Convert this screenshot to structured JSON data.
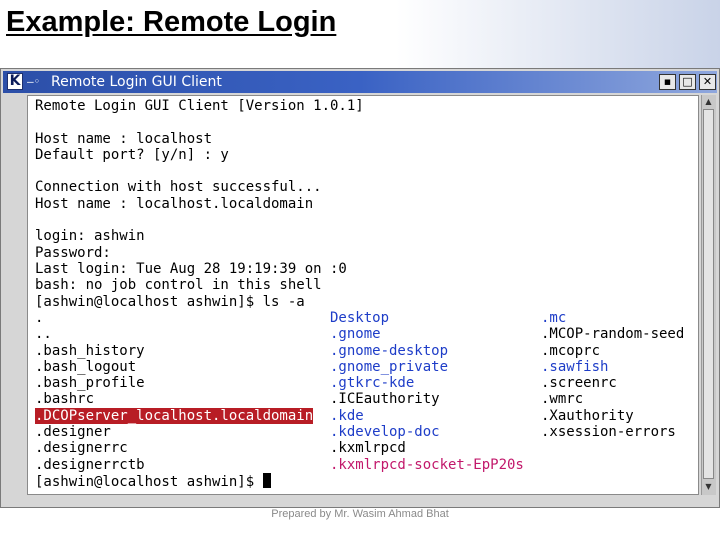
{
  "slide": {
    "title": "Example: Remote Login",
    "footer": "Prepared by Mr. Wasim Ahmad Bhat"
  },
  "window": {
    "title": "Remote Login GUI Client",
    "app_icon": "K",
    "buttons": [
      "minimize-button",
      "maximize-button",
      "close-button"
    ]
  },
  "terminal": {
    "lines": [
      "Remote Login GUI Client [Version 1.0.1]",
      "",
      "Host name : localhost",
      "Default port? [y/n] : y",
      "",
      "Connection with host successful...",
      "Host name : localhost.localdomain",
      "",
      "login: ashwin",
      "Password:",
      "Last login: Tue Aug 28 19:19:39 on :0",
      "bash: no job control in this shell",
      "[ashwin@localhost ashwin]$ ls -a"
    ],
    "ls_col1": [
      ".",
      "..",
      ".bash_history",
      ".bash_logout",
      ".bash_profile",
      ".bashrc",
      ".DCOPserver_localhost.localdomain",
      ".designer",
      ".designerrc",
      ".designerrctb"
    ],
    "ls_col2": [
      "Desktop",
      ".gnome",
      ".gnome-desktop",
      ".gnome_private",
      ".gtkrc-kde",
      ".ICEauthority",
      ".kde",
      ".kdevelop-doc",
      ".kxmlrpcd",
      ".kxmlrpcd-socket-EpP20s"
    ],
    "ls_col3": [
      ".mc",
      ".MCOP-random-seed",
      ".mcoprc",
      ".sawfish",
      ".screenrc",
      ".wmrc",
      ".Xauthority",
      ".xsession-errors"
    ],
    "prompt": "[ashwin@localhost ashwin]$ ",
    "colors": {
      "directory": "#1e3dc8",
      "highlight_bg": "#b81d25"
    }
  }
}
